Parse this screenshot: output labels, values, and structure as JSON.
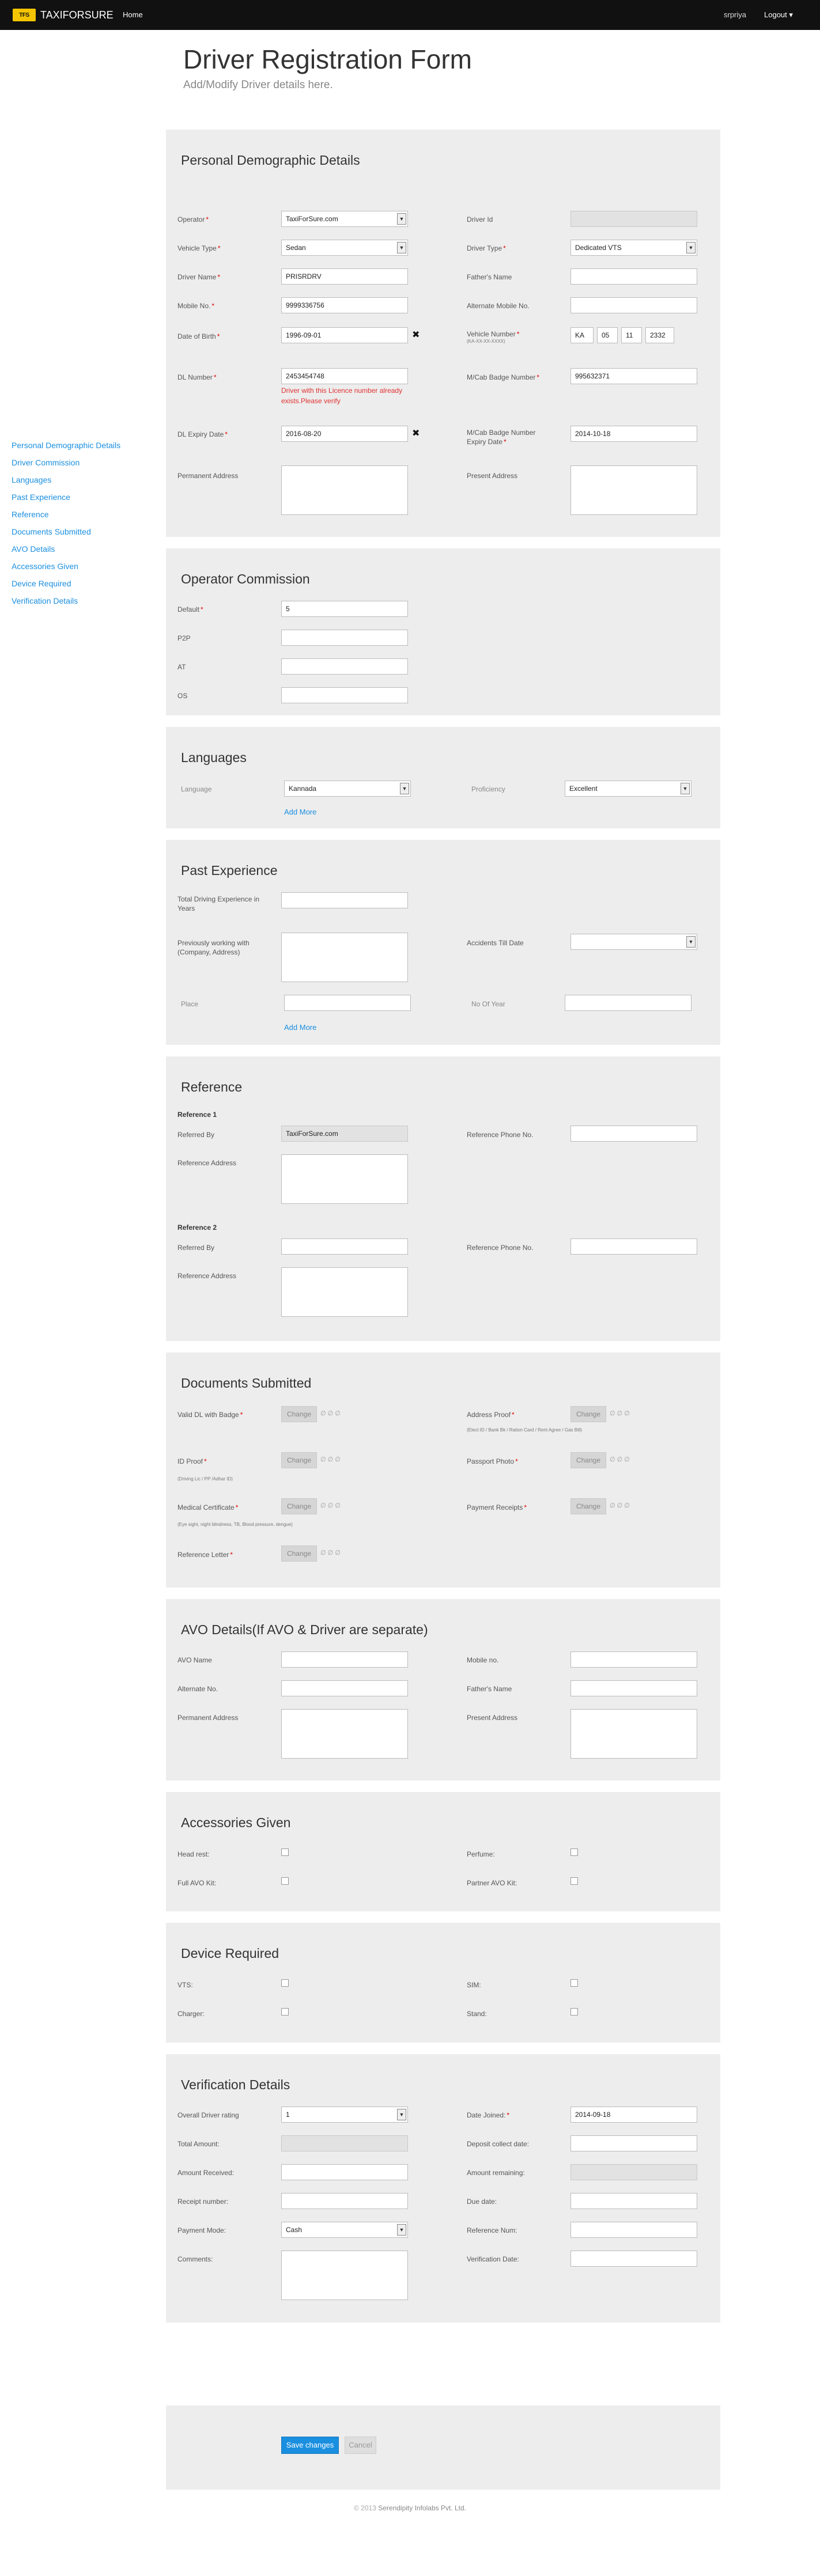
{
  "nav": {
    "logo_text": "TFS",
    "brand": "TAXIFORSURE",
    "home": "Home",
    "user": "srpriya",
    "logout": "Logout ▾"
  },
  "header": {
    "title": "Driver Registration Form",
    "subtitle": "Add/Modify Driver details here."
  },
  "sidebar": {
    "items": [
      "Personal Demographic Details",
      "Driver Commission",
      "Languages",
      "Past Experience",
      "Reference",
      "Documents Submitted",
      "AVO Details",
      "Accessories Given",
      "Device Required",
      "Verification Details"
    ]
  },
  "personal": {
    "title": "Personal Demographic Details",
    "operator_label": "Operator",
    "operator_value": "TaxiForSure.com",
    "driver_id_label": "Driver Id",
    "vehicle_type_label": "Vehicle Type",
    "vehicle_type_value": "Sedan",
    "driver_type_label": "Driver Type",
    "driver_type_value": "Dedicated VTS",
    "driver_name_label": "Driver Name",
    "driver_name_value": "PRISRDRV",
    "father_name_label": "Father's Name",
    "mobile_label": "Mobile No.",
    "mobile_value": "9999336756",
    "alt_mobile_label": "Alternate Mobile No.",
    "dob_label": "Date of Birth",
    "dob_value": "1996-09-01",
    "vehicle_number_label": "Vehicle Number",
    "vehicle_number_hint": "(KA-XX-XX-XXXX)",
    "vehicle_number_parts": [
      "KA",
      "05",
      "11",
      "2332"
    ],
    "dl_number_label": "DL Number",
    "dl_number_value": "2453454748",
    "dl_error": "Driver with this Licence number already exists.Please verify",
    "badge_label": "M/Cab Badge Number",
    "badge_value": "995632371",
    "dl_expiry_label": "DL Expiry Date",
    "dl_expiry_value": "2016-08-20",
    "badge_expiry_label": "M/Cab Badge Number Expiry Date",
    "badge_expiry_value": "2014-10-18",
    "perm_address_label": "Permanent Address",
    "present_address_label": "Present Address"
  },
  "commission": {
    "title": "Operator Commission",
    "default_label": "Default",
    "default_value": "5",
    "p2p_label": "P2P",
    "at_label": "AT",
    "os_label": "OS"
  },
  "languages": {
    "title": "Languages",
    "language_label": "Language",
    "language_value": "Kannada",
    "proficiency_label": "Proficiency",
    "proficiency_value": "Excellent",
    "add_more": "Add More"
  },
  "experience": {
    "title": "Past Experience",
    "total_label": "Total Driving Experience in Years",
    "prev_label": "Previously working with (Company, Address)",
    "accidents_label": "Accidents Till Date",
    "place_label": "Place",
    "years_label": "No Of Year",
    "add_more": "Add More"
  },
  "reference": {
    "title": "Reference",
    "ref1": "Reference 1",
    "ref2": "Reference 2",
    "referred_by_label": "Referred By",
    "referred_by_value": "TaxiForSure.com",
    "phone_label": "Reference Phone No.",
    "address_label": "Reference Address"
  },
  "documents": {
    "title": "Documents Submitted",
    "change": "Change",
    "file_note": "∅ ∅ ∅",
    "items": {
      "dl": "Valid DL with Badge",
      "address": "Address Proof",
      "address_hint": "(Elect ID / Bank Bk / Ration Card / Rent Agree / Gas Bill)",
      "id": "ID Proof",
      "id_hint": "(Driving Lic / PP /Adhar ID)",
      "passport": "Passport Photo",
      "medical": "Medical Certificate",
      "medical_hint": "(Eye sight, night blindness, TB, Blood pressure, dengue)",
      "payment": "Payment Receipts",
      "reference": "Reference Letter"
    }
  },
  "avo": {
    "title": "AVO Details(If AVO & Driver are separate)",
    "name_label": "AVO Name",
    "mobile_label": "Mobile no.",
    "alt_label": "Alternate No.",
    "father_label": "Father's Name",
    "perm_label": "Permanent Address",
    "present_label": "Present Address"
  },
  "accessories": {
    "title": "Accessories Given",
    "head_rest": "Head rest:",
    "perfume": "Perfume:",
    "full_avo": "Full AVO Kit:",
    "partner_avo": "Partner AVO Kit:"
  },
  "device": {
    "title": "Device Required",
    "vts": "VTS:",
    "sim": "SIM:",
    "charger": "Charger:",
    "stand": "Stand:"
  },
  "verification": {
    "title": "Verification Details",
    "rating_label": "Overall Driver rating",
    "rating_value": "1",
    "joined_label": "Date Joined:",
    "joined_value": "2014-09-18",
    "total_label": "Total Amount:",
    "deposit_label": "Deposit collect date:",
    "received_label": "Amount Received:",
    "remaining_label": "Amount remaining:",
    "receipt_label": "Receipt number:",
    "due_label": "Due date:",
    "payment_label": "Payment Mode:",
    "payment_value": "Cash",
    "ref_num_label": "Reference Num:",
    "comments_label": "Comments:",
    "verification_date_label": "Verification Date:"
  },
  "actions": {
    "save": "Save changes",
    "cancel": "Cancel"
  },
  "footer": {
    "text": "© 2013",
    "company": "Serendipity Infolabs Pvt. Ltd."
  }
}
